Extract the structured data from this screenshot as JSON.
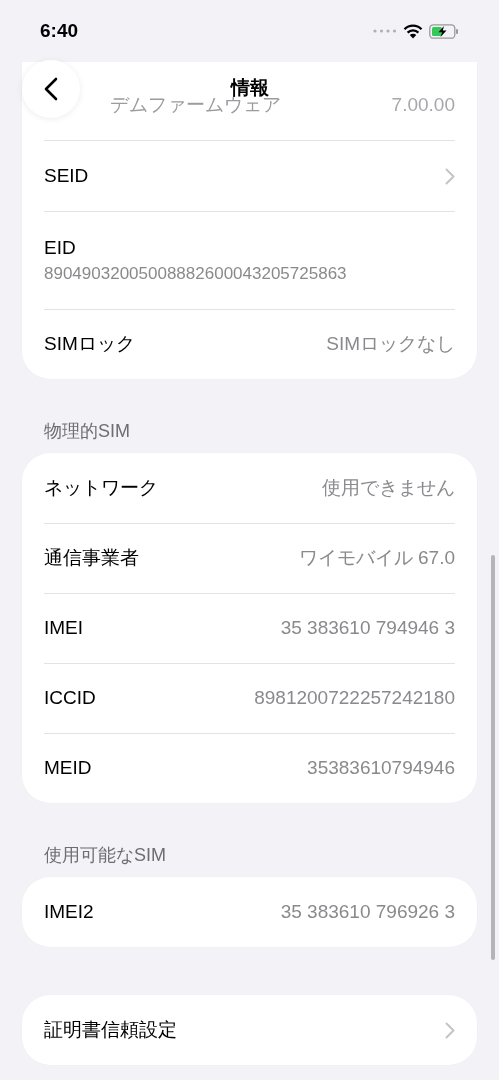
{
  "status_bar": {
    "time": "6:40"
  },
  "nav": {
    "title": "情報"
  },
  "sections": [
    {
      "rows": [
        {
          "kind": "value",
          "label": "デムファームウェア",
          "value": "7.00.00",
          "faded": true
        },
        {
          "kind": "chevron",
          "label": "SEID"
        },
        {
          "kind": "stacked",
          "label": "EID",
          "value": "89049032005008882600043205725863"
        },
        {
          "kind": "value",
          "label": "SIMロック",
          "value": "SIMロックなし"
        }
      ]
    },
    {
      "header": "物理的SIM",
      "rows": [
        {
          "kind": "value",
          "label": "ネットワーク",
          "value": "使用できません"
        },
        {
          "kind": "value",
          "label": "通信事業者",
          "value": "ワイモバイル 67.0"
        },
        {
          "kind": "value",
          "label": "IMEI",
          "value": "35 383610 794946 3"
        },
        {
          "kind": "value",
          "label": "ICCID",
          "value": "8981200722257242180"
        },
        {
          "kind": "value",
          "label": "MEID",
          "value": "35383610794946"
        }
      ]
    },
    {
      "header": "使用可能なSIM",
      "rows": [
        {
          "kind": "value",
          "label": "IMEI2",
          "value": "35 383610 796926 3"
        }
      ]
    },
    {
      "rows": [
        {
          "kind": "chevron",
          "label": "証明書信頼設定"
        }
      ]
    }
  ]
}
